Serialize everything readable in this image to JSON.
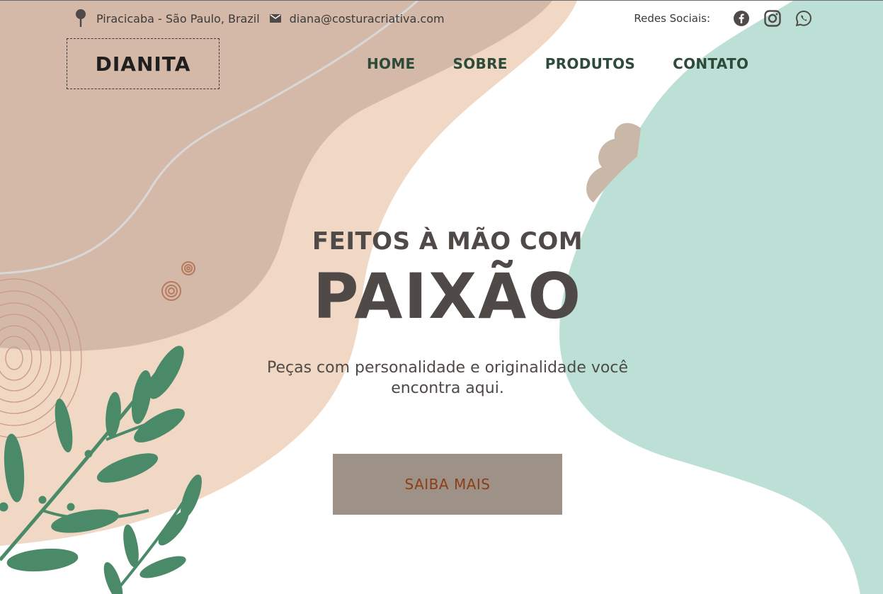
{
  "topbar": {
    "location": "Piracicaba - São Paulo, Brazil",
    "email": "diana@costuracriativa.com",
    "social_label": "Redes Sociais:",
    "social_icons": [
      "facebook-icon",
      "instagram-icon",
      "whatsapp-icon"
    ]
  },
  "logo": {
    "text": "DIANITA"
  },
  "nav": {
    "items": [
      {
        "label": "HOME"
      },
      {
        "label": "SOBRE"
      },
      {
        "label": "PRODUTOS"
      },
      {
        "label": "CONTATO"
      }
    ]
  },
  "hero": {
    "subtitle": "FEITOS À MÃO COM",
    "title": "PAIXÃO",
    "description": "Peças com personalidade e originalidade você encontra aqui.",
    "cta_label": "SAIBA MAIS"
  },
  "colors": {
    "nav_text": "#2e4a3a",
    "hero_text": "#4f4a47",
    "cta_bg": "#9e9188",
    "cta_text": "#8a3f14",
    "blob_brown": "#d4b9a9",
    "blob_peach": "#f1d8c5",
    "blob_mint": "#bce0d5",
    "leaf_green": "#4b8a68"
  }
}
